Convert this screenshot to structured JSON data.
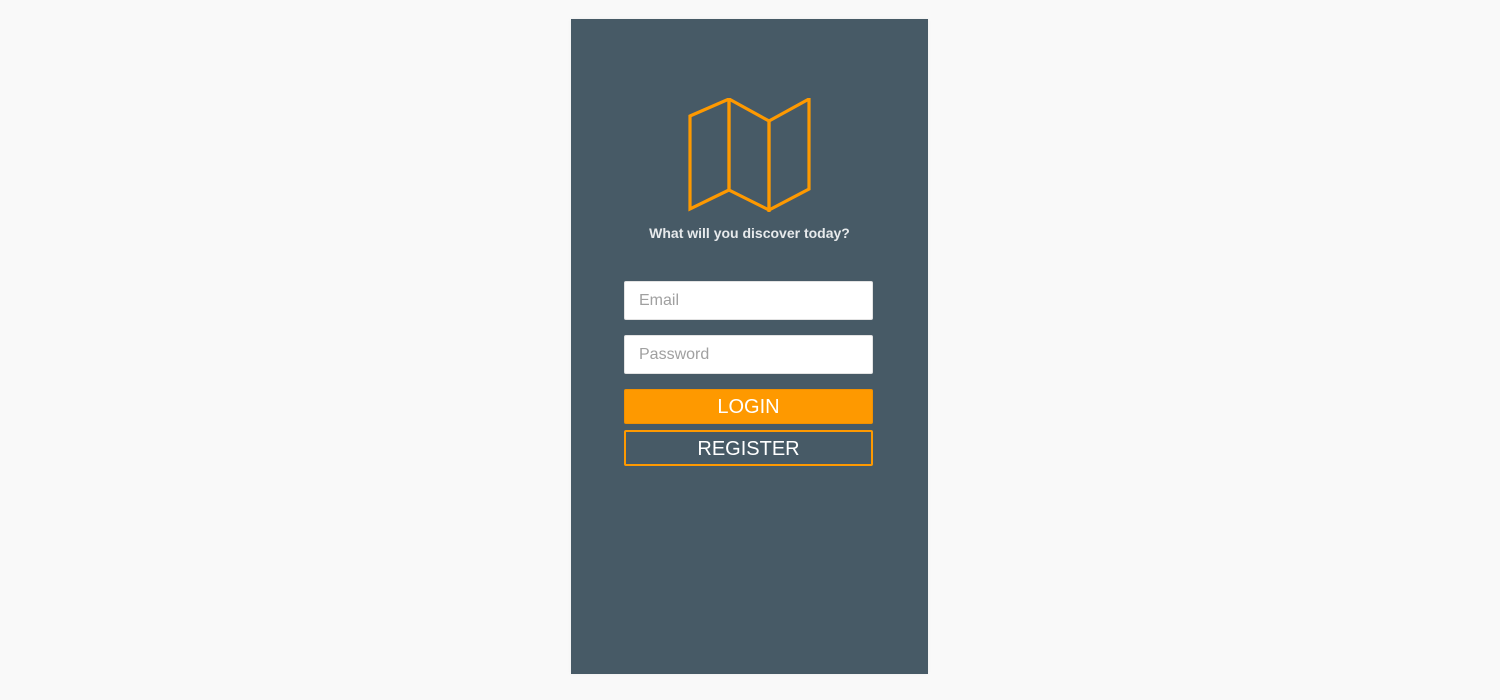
{
  "theme": {
    "page_background": "#f9f9f9",
    "card_background": "#475a66",
    "accent": "#fe9900",
    "text_light": "#e7eaec"
  },
  "logo": {
    "icon": "folded-map-icon"
  },
  "tagline": "What will you discover today?",
  "form": {
    "email_placeholder": "Email",
    "email_value": "",
    "password_placeholder": "Password",
    "password_value": ""
  },
  "buttons": {
    "login_label": "LOGIN",
    "register_label": "REGISTER"
  }
}
